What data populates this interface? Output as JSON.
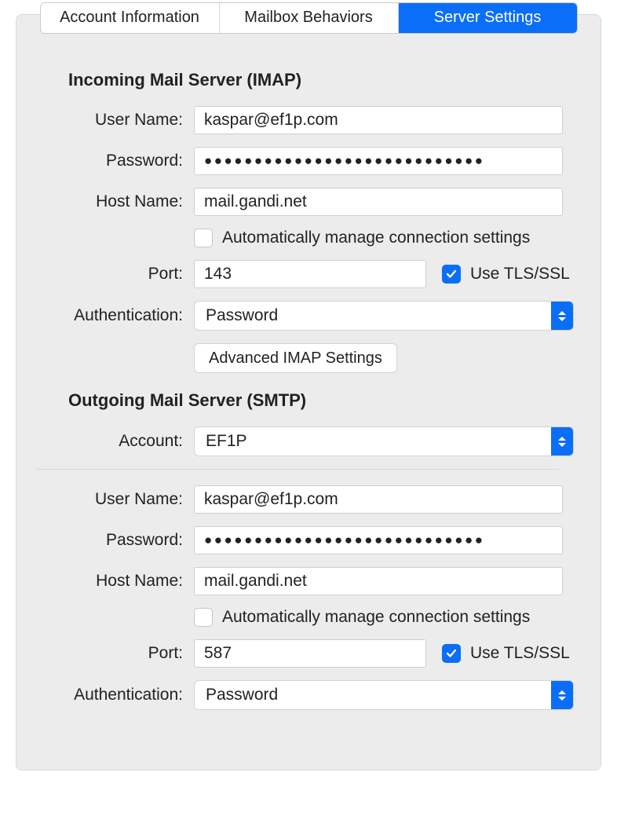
{
  "tabs": {
    "account_info": "Account Information",
    "mailbox_behaviors": "Mailbox Behaviors",
    "server_settings": "Server Settings"
  },
  "incoming": {
    "title": "Incoming Mail Server (IMAP)",
    "labels": {
      "user_name": "User Name:",
      "password": "Password:",
      "host_name": "Host Name:",
      "port": "Port:",
      "authentication": "Authentication:"
    },
    "user_name": "kaspar@ef1p.com",
    "password_mask": "●●●●●●●●●●●●●●●●●●●●●●●●●●●●",
    "host_name": "mail.gandi.net",
    "auto_manage_label": "Automatically manage connection settings",
    "port": "143",
    "use_tls_label": "Use TLS/SSL",
    "authentication": "Password",
    "advanced_button": "Advanced IMAP Settings"
  },
  "outgoing": {
    "title": "Outgoing Mail Server (SMTP)",
    "labels": {
      "account": "Account:",
      "user_name": "User Name:",
      "password": "Password:",
      "host_name": "Host Name:",
      "port": "Port:",
      "authentication": "Authentication:"
    },
    "account": "EF1P",
    "user_name": "kaspar@ef1p.com",
    "password_mask": "●●●●●●●●●●●●●●●●●●●●●●●●●●●●",
    "host_name": "mail.gandi.net",
    "auto_manage_label": "Automatically manage connection settings",
    "port": "587",
    "use_tls_label": "Use TLS/SSL",
    "authentication": "Password"
  }
}
